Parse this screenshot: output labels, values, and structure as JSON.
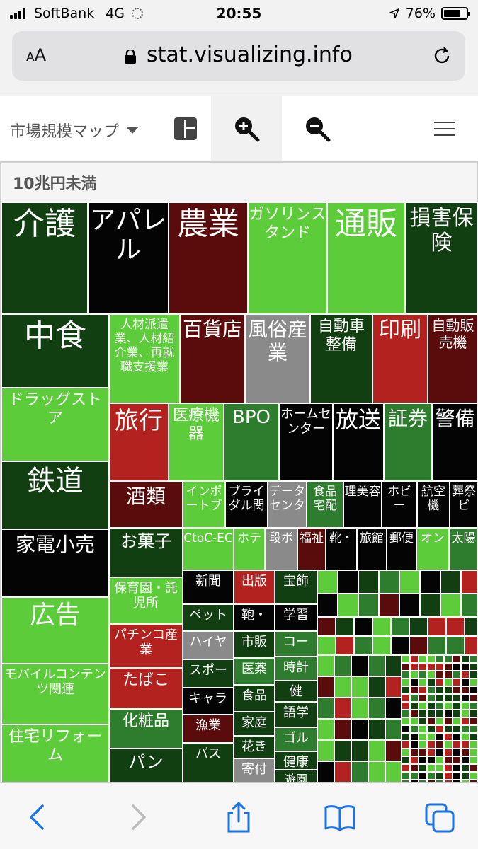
{
  "status": {
    "carrier": "SoftBank",
    "network": "4G",
    "time": "20:55",
    "battery": "76%",
    "battery_level": 0.76
  },
  "browser": {
    "aa_label": "AA",
    "url": "stat.visualizing.info"
  },
  "toolbar": {
    "map_select": "市場規模マップ"
  },
  "group": {
    "title": "10兆円未満"
  },
  "colors": {
    "dark_green": "#123f12",
    "mid_green": "#2e7d2e",
    "light_green": "#5ccc3a",
    "black": "#040404",
    "dark_red": "#5a0c0c",
    "red": "#b3221e",
    "gray": "#8a8a8a"
  },
  "cells": [
    "介護",
    "アパレル",
    "農業",
    "ガソリンスタンド",
    "通販",
    "損害保険",
    "中食",
    "人材派遣業、人材紹介業、再就職支援業",
    "百貨店",
    "風俗産業",
    "自動車整備",
    "印刷",
    "自動販売機",
    "ドラッグストア",
    "旅行",
    "医療機器",
    "BPO",
    "ホームセンター",
    "放送",
    "証券",
    "警備",
    "鉄道",
    "酒類",
    "インポートブ",
    "ブライダル関",
    "データセンタ",
    "食品宅配",
    "理美容",
    "ホビー",
    "航空機",
    "葬祭ビ",
    "家電小売",
    "お菓子",
    "CtoC-EC",
    "ホテ",
    "段ボ",
    "福祉",
    "靴・",
    "旅館",
    "郵便",
    "オン",
    "太陽",
    "広告",
    "保育園・託児所",
    "新聞",
    "出版",
    "宝飾",
    "ペット",
    "鞄・",
    "学習",
    "パチンコ産業",
    "ハイヤ",
    "市販",
    "コー",
    "モバイルコンテンツ関連",
    "たばこ",
    "スポー",
    "医薬",
    "時計",
    "キャラ",
    "食品",
    "健",
    "化粧品",
    "漁業",
    "家庭",
    "語学",
    "住宅リフォーム",
    "ゴル",
    "花き",
    "パン",
    "バス",
    "寄付",
    "健康",
    "遊園"
  ]
}
